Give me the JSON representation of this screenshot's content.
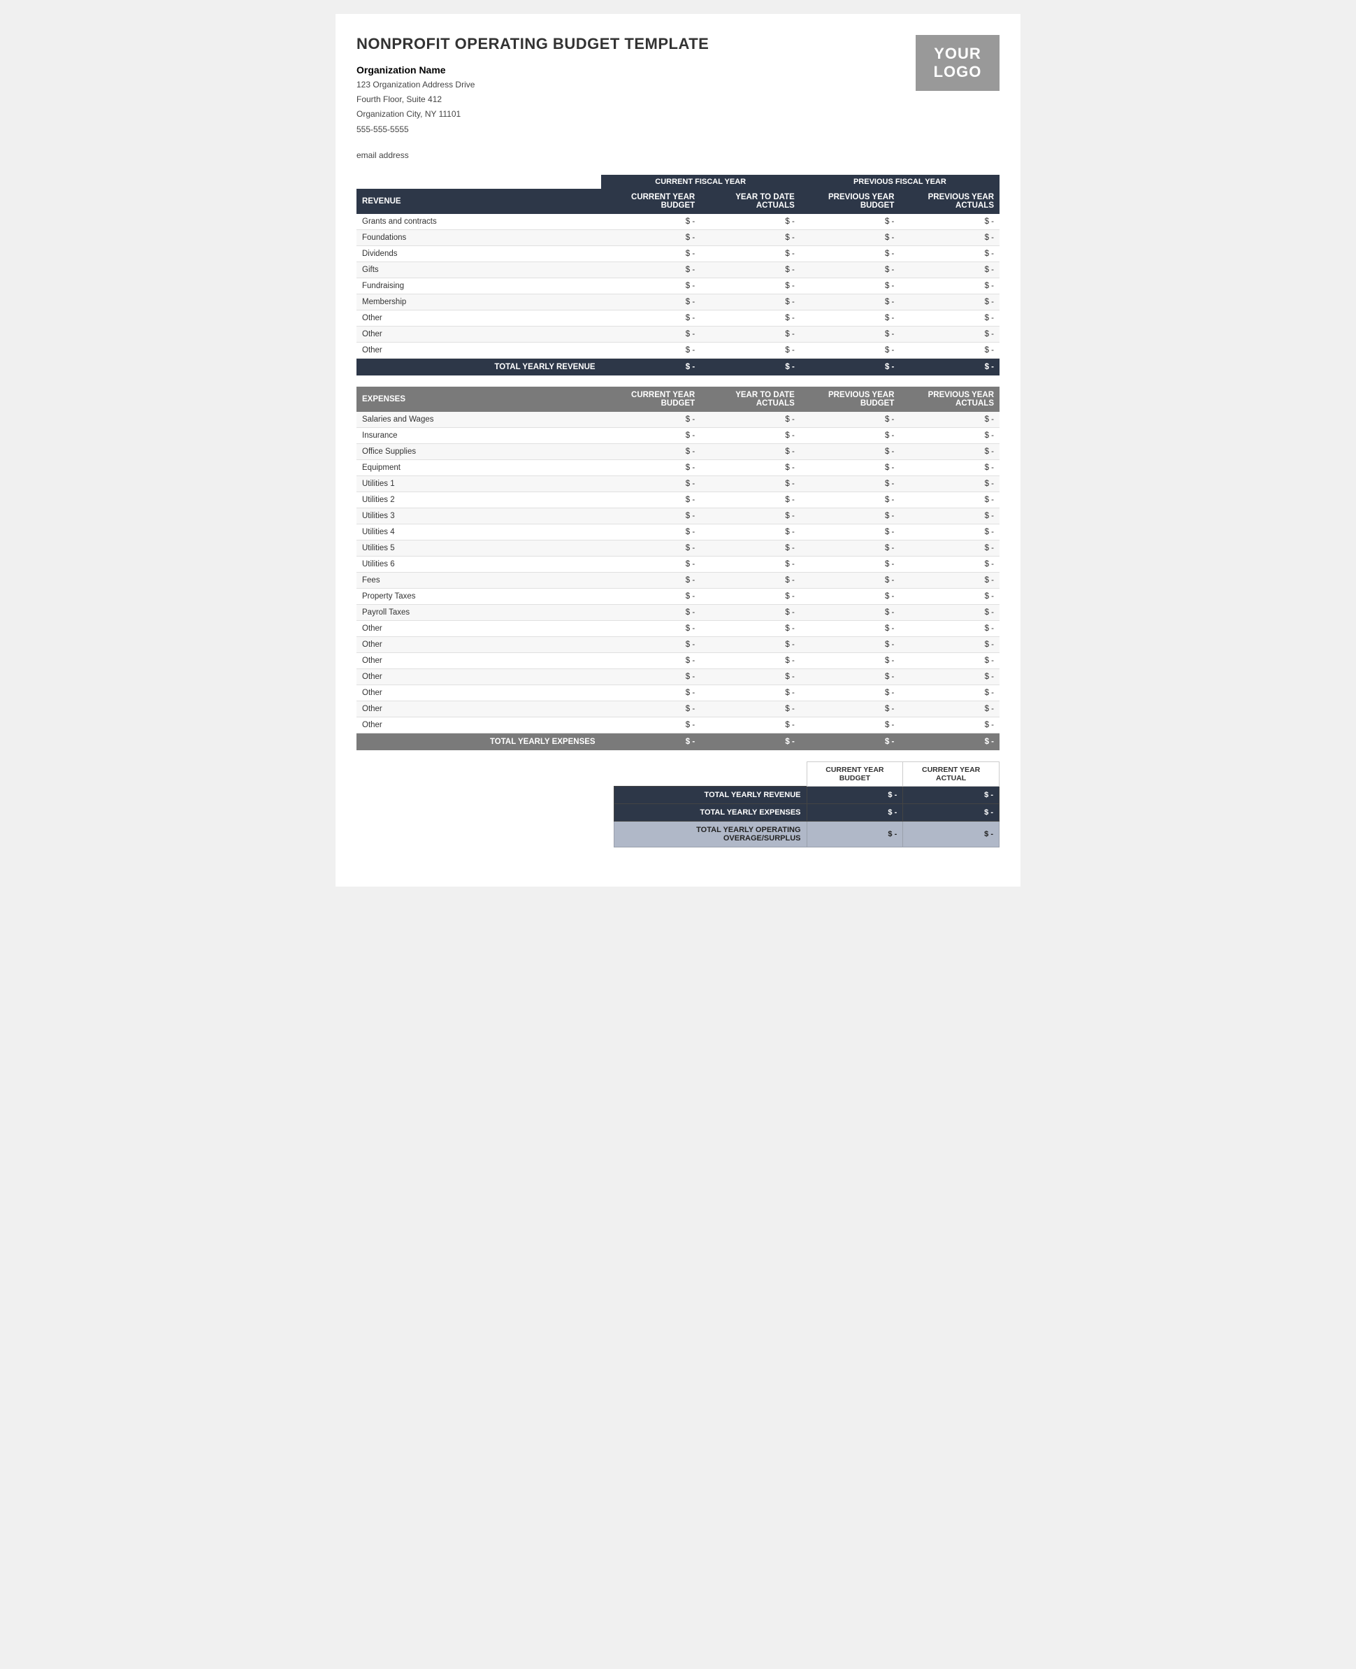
{
  "page": {
    "title": "NONPROFIT OPERATING BUDGET TEMPLATE",
    "logo": "YOUR\nLOGO"
  },
  "org": {
    "name": "Organization Name",
    "address1": "123 Organization Address Drive",
    "address2": "Fourth Floor, Suite 412",
    "address3": "Organization City, NY  11101",
    "phone": "555-555-5555",
    "email": "email address"
  },
  "fiscal_headers": {
    "current": "CURRENT FISCAL YEAR",
    "previous": "PREVIOUS FISCAL YEAR"
  },
  "revenue": {
    "section_label": "REVENUE",
    "col1": "CURRENT YEAR BUDGET",
    "col2": "YEAR TO DATE ACTUALS",
    "col3": "PREVIOUS YEAR BUDGET",
    "col4": "PREVIOUS YEAR ACTUALS",
    "rows": [
      {
        "label": "Grants and contracts",
        "c1": "$ -",
        "c2": "$ -",
        "c3": "$ -",
        "c4": "$ -"
      },
      {
        "label": "Foundations",
        "c1": "$ -",
        "c2": "$ -",
        "c3": "$ -",
        "c4": "$ -"
      },
      {
        "label": "Dividends",
        "c1": "$ -",
        "c2": "$ -",
        "c3": "$ -",
        "c4": "$ -"
      },
      {
        "label": "Gifts",
        "c1": "$ -",
        "c2": "$ -",
        "c3": "$ -",
        "c4": "$ -"
      },
      {
        "label": "Fundraising",
        "c1": "$ -",
        "c2": "$ -",
        "c3": "$ -",
        "c4": "$ -"
      },
      {
        "label": "Membership",
        "c1": "$ -",
        "c2": "$ -",
        "c3": "$ -",
        "c4": "$ -"
      },
      {
        "label": "Other",
        "c1": "$ -",
        "c2": "$ -",
        "c3": "$ -",
        "c4": "$ -"
      },
      {
        "label": "Other",
        "c1": "$ -",
        "c2": "$ -",
        "c3": "$ -",
        "c4": "$ -"
      },
      {
        "label": "Other",
        "c1": "$ -",
        "c2": "$ -",
        "c3": "$ -",
        "c4": "$ -"
      }
    ],
    "total_label": "TOTAL YEARLY REVENUE",
    "total_c1": "$ -",
    "total_c2": "$ -",
    "total_c3": "$ -",
    "total_c4": "$ -"
  },
  "expenses": {
    "section_label": "EXPENSES",
    "col1": "CURRENT YEAR BUDGET",
    "col2": "YEAR TO DATE ACTUALS",
    "col3": "PREVIOUS YEAR BUDGET",
    "col4": "PREVIOUS YEAR ACTUALS",
    "rows": [
      {
        "label": "Salaries and Wages",
        "c1": "$ -",
        "c2": "$ -",
        "c3": "$ -",
        "c4": "$ -"
      },
      {
        "label": "Insurance",
        "c1": "$ -",
        "c2": "$ -",
        "c3": "$ -",
        "c4": "$ -"
      },
      {
        "label": "Office Supplies",
        "c1": "$ -",
        "c2": "$ -",
        "c3": "$ -",
        "c4": "$ -"
      },
      {
        "label": "Equipment",
        "c1": "$ -",
        "c2": "$ -",
        "c3": "$ -",
        "c4": "$ -"
      },
      {
        "label": "Utilities 1",
        "c1": "$ -",
        "c2": "$ -",
        "c3": "$ -",
        "c4": "$ -"
      },
      {
        "label": "Utilities 2",
        "c1": "$ -",
        "c2": "$ -",
        "c3": "$ -",
        "c4": "$ -"
      },
      {
        "label": "Utilities 3",
        "c1": "$ -",
        "c2": "$ -",
        "c3": "$ -",
        "c4": "$ -"
      },
      {
        "label": "Utilities 4",
        "c1": "$ -",
        "c2": "$ -",
        "c3": "$ -",
        "c4": "$ -"
      },
      {
        "label": "Utilities 5",
        "c1": "$ -",
        "c2": "$ -",
        "c3": "$ -",
        "c4": "$ -"
      },
      {
        "label": "Utilities 6",
        "c1": "$ -",
        "c2": "$ -",
        "c3": "$ -",
        "c4": "$ -"
      },
      {
        "label": "Fees",
        "c1": "$ -",
        "c2": "$ -",
        "c3": "$ -",
        "c4": "$ -"
      },
      {
        "label": "Property Taxes",
        "c1": "$ -",
        "c2": "$ -",
        "c3": "$ -",
        "c4": "$ -"
      },
      {
        "label": "Payroll Taxes",
        "c1": "$ -",
        "c2": "$ -",
        "c3": "$ -",
        "c4": "$ -"
      },
      {
        "label": "Other",
        "c1": "$ -",
        "c2": "$ -",
        "c3": "$ -",
        "c4": "$ -"
      },
      {
        "label": "Other",
        "c1": "$ -",
        "c2": "$ -",
        "c3": "$ -",
        "c4": "$ -"
      },
      {
        "label": "Other",
        "c1": "$ -",
        "c2": "$ -",
        "c3": "$ -",
        "c4": "$ -"
      },
      {
        "label": "Other",
        "c1": "$ -",
        "c2": "$ -",
        "c3": "$ -",
        "c4": "$ -"
      },
      {
        "label": "Other",
        "c1": "$ -",
        "c2": "$ -",
        "c3": "$ -",
        "c4": "$ -"
      },
      {
        "label": "Other",
        "c1": "$ -",
        "c2": "$ -",
        "c3": "$ -",
        "c4": "$ -"
      },
      {
        "label": "Other",
        "c1": "$ -",
        "c2": "$ -",
        "c3": "$ -",
        "c4": "$ -"
      }
    ],
    "total_label": "TOTAL YEARLY EXPENSES",
    "total_c1": "$ -",
    "total_c2": "$ -",
    "total_c3": "$ -",
    "total_c4": "$ -"
  },
  "summary": {
    "col1": "CURRENT YEAR BUDGET",
    "col2": "CURRENT YEAR ACTUAL",
    "rows": [
      {
        "label": "TOTAL YEARLY REVENUE",
        "c1": "$ -",
        "c2": "$ -"
      },
      {
        "label": "TOTAL YEARLY EXPENSES",
        "c1": "$ -",
        "c2": "$ -"
      },
      {
        "label": "TOTAL YEARLY OPERATING OVERAGE/SURPLUS",
        "c1": "$ -",
        "c2": "$ -"
      }
    ]
  }
}
